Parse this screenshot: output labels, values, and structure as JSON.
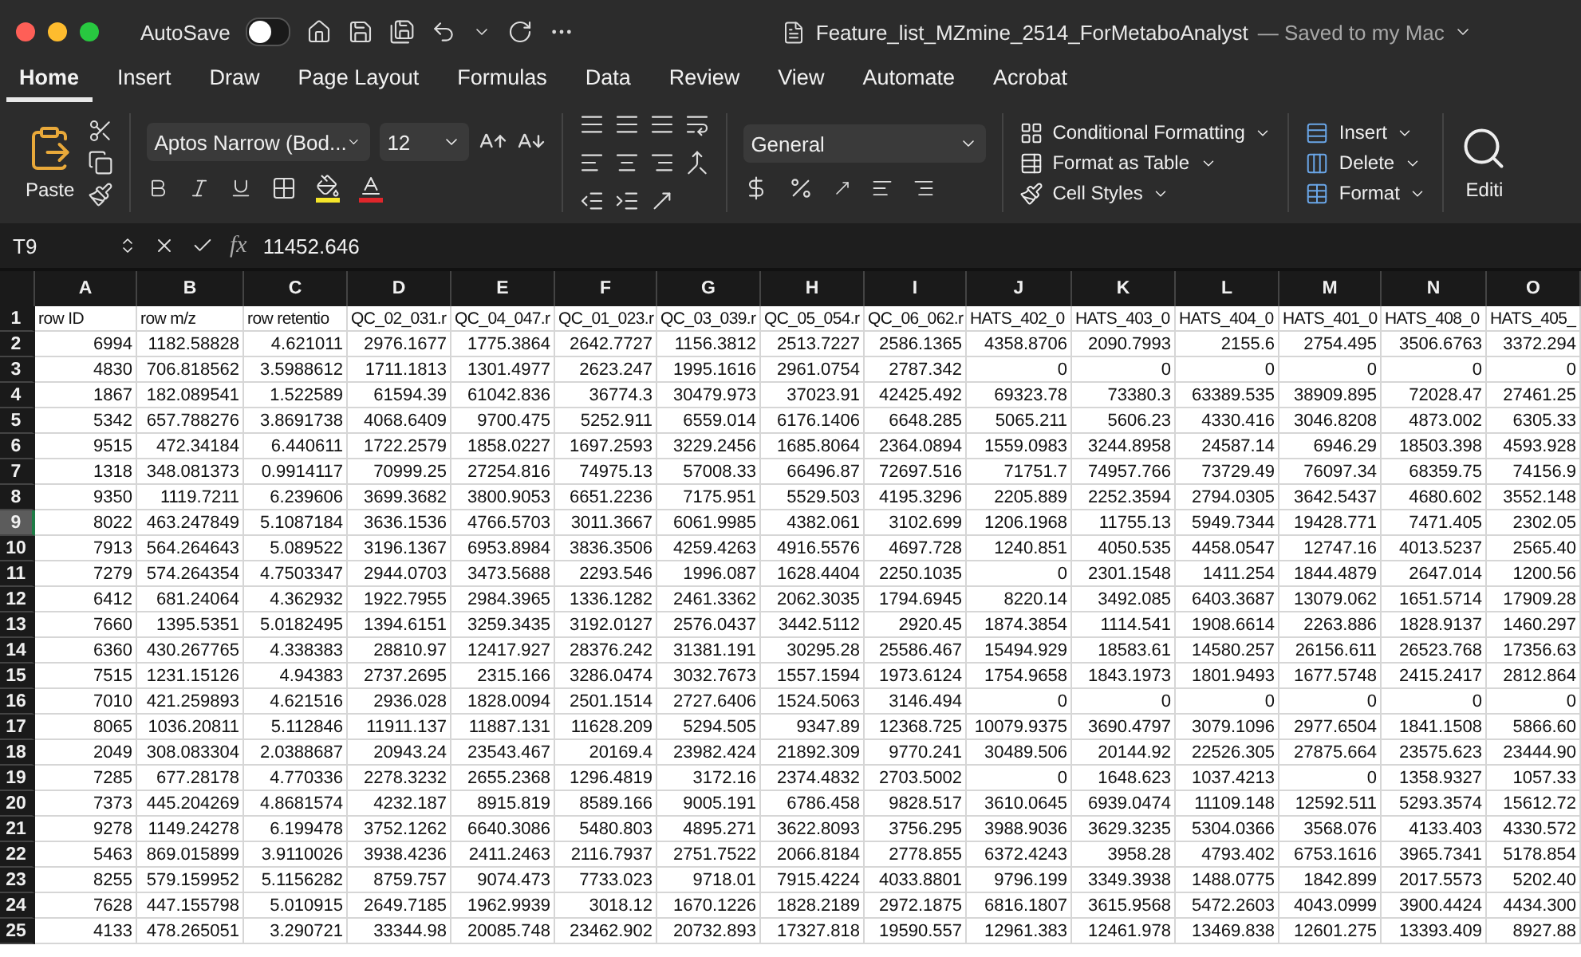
{
  "window": {
    "autosave_label": "AutoSave",
    "autosave_on": false,
    "title": "Feature_list_MZmine_2514_ForMetaboAnalyst",
    "save_status": "— Saved to my Mac"
  },
  "tabs": [
    {
      "label": "Home",
      "selected": true
    },
    {
      "label": "Insert",
      "selected": false
    },
    {
      "label": "Draw",
      "selected": false
    },
    {
      "label": "Page Layout",
      "selected": false
    },
    {
      "label": "Formulas",
      "selected": false
    },
    {
      "label": "Data",
      "selected": false
    },
    {
      "label": "Review",
      "selected": false
    },
    {
      "label": "View",
      "selected": false
    },
    {
      "label": "Automate",
      "selected": false
    },
    {
      "label": "Acrobat",
      "selected": false
    }
  ],
  "ribbon": {
    "paste_label": "Paste",
    "font_name": "Aptos Narrow (Bod...",
    "font_size": "12",
    "number_format": "General",
    "styles": [
      "Conditional Formatting",
      "Format as Table",
      "Cell Styles"
    ],
    "cells": [
      "Insert",
      "Delete",
      "Format"
    ],
    "editing": "Editi"
  },
  "formula_bar": {
    "name_box": "T9",
    "fx": "fx",
    "value": "11452.646"
  },
  "sheet": {
    "columns": [
      "A",
      "B",
      "C",
      "D",
      "E",
      "F",
      "G",
      "H",
      "I",
      "J",
      "K",
      "L",
      "M",
      "N",
      "O"
    ],
    "rows": [
      {
        "number": "1",
        "selected": false,
        "kind": "labels",
        "cells": [
          "row ID",
          "row m/z",
          "row retentio",
          "QC_02_031.r",
          "QC_04_047.r",
          "QC_01_023.r",
          "QC_03_039.r",
          "QC_05_054.r",
          "QC_06_062.r",
          "HATS_402_0",
          "HATS_403_0",
          "HATS_404_0",
          "HATS_401_0",
          "HATS_408_0",
          "HATS_405_"
        ]
      },
      {
        "number": "2",
        "selected": false,
        "kind": "values",
        "cells": [
          "6994",
          "1182.58828",
          "4.621011",
          "2976.1677",
          "1775.3864",
          "2642.7727",
          "1156.3812",
          "2513.7227",
          "2586.1365",
          "4358.8706",
          "2090.7993",
          "2155.6",
          "2754.495",
          "3506.6763",
          "3372.294"
        ]
      },
      {
        "number": "3",
        "selected": false,
        "kind": "values",
        "cells": [
          "4830",
          "706.818562",
          "3.5988612",
          "1711.1813",
          "1301.4977",
          "2623.247",
          "1995.1616",
          "2961.0754",
          "2787.342",
          "0",
          "0",
          "0",
          "0",
          "0",
          "0"
        ]
      },
      {
        "number": "4",
        "selected": false,
        "kind": "values",
        "cells": [
          "1867",
          "182.089541",
          "1.522589",
          "61594.39",
          "61042.836",
          "36774.3",
          "30479.973",
          "37023.91",
          "42425.492",
          "69323.78",
          "73380.3",
          "63389.535",
          "38909.895",
          "72028.47",
          "27461.25"
        ]
      },
      {
        "number": "5",
        "selected": false,
        "kind": "values",
        "cells": [
          "5342",
          "657.788276",
          "3.8691738",
          "4068.6409",
          "9700.475",
          "5252.911",
          "6559.014",
          "6176.1406",
          "6648.285",
          "5065.211",
          "5606.23",
          "4330.416",
          "3046.8208",
          "4873.002",
          "6305.33"
        ]
      },
      {
        "number": "6",
        "selected": false,
        "kind": "values",
        "cells": [
          "9515",
          "472.34184",
          "6.440611",
          "1722.2579",
          "1858.0227",
          "1697.2593",
          "3229.2456",
          "1685.8064",
          "2364.0894",
          "1559.0983",
          "3244.8958",
          "24587.14",
          "6946.29",
          "18503.398",
          "4593.928"
        ]
      },
      {
        "number": "7",
        "selected": false,
        "kind": "values",
        "cells": [
          "1318",
          "348.081373",
          "0.9914117",
          "70999.25",
          "27254.816",
          "74975.13",
          "57008.33",
          "66496.87",
          "72697.516",
          "71751.7",
          "74957.766",
          "73729.49",
          "76097.34",
          "68359.75",
          "74156.9"
        ]
      },
      {
        "number": "8",
        "selected": false,
        "kind": "values",
        "cells": [
          "9350",
          "1119.7211",
          "6.239606",
          "3699.3682",
          "3800.9053",
          "6651.2236",
          "7175.951",
          "5529.503",
          "4195.3296",
          "2205.889",
          "2252.3594",
          "2794.0305",
          "3642.5437",
          "4680.602",
          "3552.148"
        ]
      },
      {
        "number": "9",
        "selected": true,
        "kind": "values",
        "cells": [
          "8022",
          "463.247849",
          "5.1087184",
          "3636.1536",
          "4766.5703",
          "3011.3667",
          "6061.9985",
          "4382.061",
          "3102.699",
          "1206.1968",
          "11755.13",
          "5949.7344",
          "19428.771",
          "7471.405",
          "2302.05"
        ]
      },
      {
        "number": "10",
        "selected": false,
        "kind": "values",
        "cells": [
          "7913",
          "564.264643",
          "5.089522",
          "3196.1367",
          "6953.8984",
          "3836.3506",
          "4259.4263",
          "4916.5576",
          "4697.728",
          "1240.851",
          "4050.535",
          "4458.0547",
          "12747.16",
          "4013.5237",
          "2565.40"
        ]
      },
      {
        "number": "11",
        "selected": false,
        "kind": "values",
        "cells": [
          "7279",
          "574.264354",
          "4.7503347",
          "2944.0703",
          "3473.5688",
          "2293.546",
          "1996.087",
          "1628.4404",
          "2250.1035",
          "0",
          "2301.1548",
          "1411.254",
          "1844.4879",
          "2647.014",
          "1200.56"
        ]
      },
      {
        "number": "12",
        "selected": false,
        "kind": "values",
        "cells": [
          "6412",
          "681.24064",
          "4.362932",
          "1922.7955",
          "2984.3965",
          "1336.1282",
          "2461.3362",
          "2062.3035",
          "1794.6945",
          "8220.14",
          "3492.085",
          "6403.3687",
          "13079.062",
          "1651.5714",
          "17909.28"
        ]
      },
      {
        "number": "13",
        "selected": false,
        "kind": "values",
        "cells": [
          "7660",
          "1395.5351",
          "5.0182495",
          "1394.6151",
          "3259.3435",
          "3192.0127",
          "2576.0437",
          "3442.5112",
          "2920.45",
          "1874.3854",
          "1114.541",
          "1908.6614",
          "2263.886",
          "1828.9137",
          "1460.297"
        ]
      },
      {
        "number": "14",
        "selected": false,
        "kind": "values",
        "cells": [
          "6360",
          "430.267765",
          "4.338383",
          "28810.97",
          "12417.927",
          "28376.242",
          "31381.191",
          "30295.28",
          "25586.467",
          "15494.929",
          "18583.61",
          "14580.257",
          "26156.611",
          "26523.768",
          "17356.63"
        ]
      },
      {
        "number": "15",
        "selected": false,
        "kind": "values",
        "cells": [
          "7515",
          "1231.15126",
          "4.94383",
          "2737.2695",
          "2315.166",
          "3286.0474",
          "3032.7673",
          "1557.1594",
          "1973.6124",
          "1754.9658",
          "1843.1973",
          "1801.9493",
          "1677.5748",
          "2415.2417",
          "2812.864"
        ]
      },
      {
        "number": "16",
        "selected": false,
        "kind": "values",
        "cells": [
          "7010",
          "421.259893",
          "4.621516",
          "2936.028",
          "1828.0094",
          "2501.1514",
          "2727.6406",
          "1524.5063",
          "3146.494",
          "0",
          "0",
          "0",
          "0",
          "0",
          "0"
        ]
      },
      {
        "number": "17",
        "selected": false,
        "kind": "values",
        "cells": [
          "8065",
          "1036.20811",
          "5.112846",
          "11911.137",
          "11887.131",
          "11628.209",
          "5294.505",
          "9347.89",
          "12368.725",
          "10079.9375",
          "3690.4797",
          "3079.1096",
          "2977.6504",
          "1841.1508",
          "5866.60"
        ]
      },
      {
        "number": "18",
        "selected": false,
        "kind": "values",
        "cells": [
          "2049",
          "308.083304",
          "2.0388687",
          "20943.24",
          "23543.467",
          "20169.4",
          "23982.424",
          "21892.309",
          "9770.241",
          "30489.506",
          "20144.92",
          "22526.305",
          "27875.664",
          "23575.623",
          "23444.90"
        ]
      },
      {
        "number": "19",
        "selected": false,
        "kind": "values",
        "cells": [
          "7285",
          "677.28178",
          "4.770336",
          "2278.3232",
          "2655.2368",
          "1296.4819",
          "3172.16",
          "2374.4832",
          "2703.5002",
          "0",
          "1648.623",
          "1037.4213",
          "0",
          "1358.9327",
          "1057.33"
        ]
      },
      {
        "number": "20",
        "selected": false,
        "kind": "values",
        "cells": [
          "7373",
          "445.204269",
          "4.8681574",
          "4232.187",
          "8915.819",
          "8589.166",
          "9005.191",
          "6786.458",
          "9828.517",
          "3610.0645",
          "6939.0474",
          "11109.148",
          "12592.511",
          "5293.3574",
          "15612.72"
        ]
      },
      {
        "number": "21",
        "selected": false,
        "kind": "values",
        "cells": [
          "9278",
          "1149.24278",
          "6.199478",
          "3752.1262",
          "6640.3086",
          "5480.803",
          "4895.271",
          "3622.8093",
          "3756.295",
          "3988.9036",
          "3629.3235",
          "5304.0366",
          "3568.076",
          "4133.403",
          "4330.572"
        ]
      },
      {
        "number": "22",
        "selected": false,
        "kind": "values",
        "cells": [
          "5463",
          "869.015899",
          "3.9110026",
          "3938.4236",
          "2411.2463",
          "2116.7937",
          "2751.7522",
          "2066.8184",
          "2778.855",
          "6372.4243",
          "3958.28",
          "4793.402",
          "6753.1616",
          "3965.7341",
          "5178.854"
        ]
      },
      {
        "number": "23",
        "selected": false,
        "kind": "values",
        "cells": [
          "8255",
          "579.159952",
          "5.1156282",
          "8759.757",
          "9074.473",
          "7733.023",
          "9718.01",
          "7915.4224",
          "4033.8801",
          "9796.199",
          "3349.3938",
          "1488.0775",
          "1842.899",
          "2017.5573",
          "5202.40"
        ]
      },
      {
        "number": "24",
        "selected": false,
        "kind": "values",
        "cells": [
          "7628",
          "447.155798",
          "5.010915",
          "2649.7185",
          "1962.9939",
          "3018.12",
          "1670.1226",
          "1828.2189",
          "2972.1875",
          "6816.1807",
          "3615.9568",
          "5472.2603",
          "4043.0999",
          "3900.4424",
          "4434.300"
        ]
      },
      {
        "number": "25",
        "selected": false,
        "kind": "values",
        "cells": [
          "4133",
          "478.265051",
          "3.290721",
          "33344.98",
          "20085.748",
          "23462.902",
          "20732.893",
          "17327.818",
          "19590.557",
          "12961.383",
          "12461.978",
          "13469.838",
          "12601.275",
          "13393.409",
          "8927.88"
        ]
      }
    ]
  }
}
